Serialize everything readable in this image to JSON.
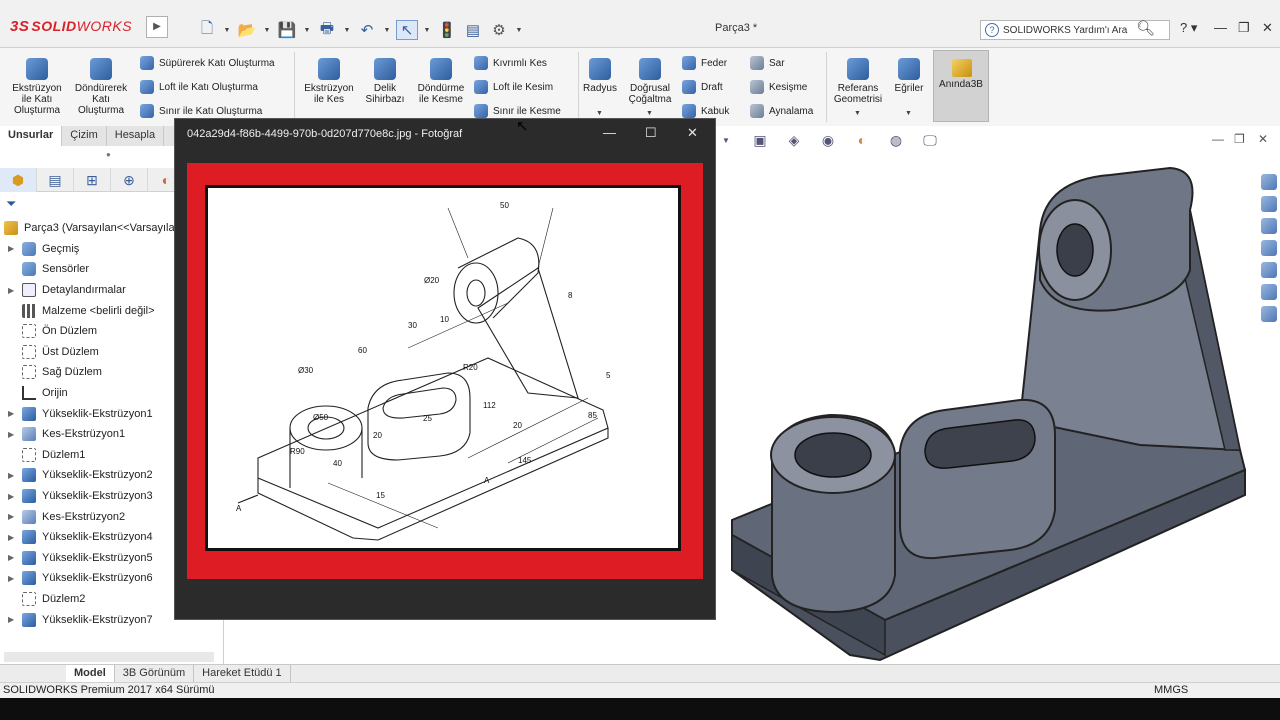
{
  "app": {
    "logo_ds": "3S",
    "logo_solid": "SOLID",
    "logo_works": "WORKS",
    "document_title": "Parça3 *",
    "help_search_placeholder": "SOLIDWORKS Yardım'ı Ara"
  },
  "ribbon": {
    "extrude_boss": "Ekstrüzyon ile Katı Oluşturma",
    "revolve_boss": "Döndürerek Katı Oluşturma",
    "sweep_boss": "Süpürerek Katı Oluşturma",
    "loft_boss": "Loft ile Katı Oluşturma",
    "boundary_boss": "Sınır ile Katı Oluşturma",
    "extrude_cut": "Ekstrüzyon ile Kes",
    "hole_wizard": "Delik Sihirbazı",
    "revolve_cut": "Döndürme ile Kesme",
    "swept_cut": "Kıvrımlı Kes",
    "loft_cut": "Loft ile Kesim",
    "boundary_cut": "Sınır ile Kesme",
    "fillet": "Radyus",
    "linear_pattern": "Doğrusal Çoğaltma",
    "rib": "Feder",
    "draft": "Draft",
    "shell": "Kabuk",
    "wrap": "Sar",
    "intersect": "Kesişme",
    "mirror": "Aynalama",
    "ref_geometry": "Referans Geometrisi",
    "curves": "Eğriler",
    "instant3d": "Anında3B"
  },
  "tabs": {
    "features": "Unsurlar",
    "sketch": "Çizim",
    "evaluate": "Hesapla"
  },
  "tree": {
    "root": "Parça3  (Varsayılan<<Varsayılan",
    "items": [
      {
        "label": "Geçmiş",
        "icon": "folder",
        "exp": true
      },
      {
        "label": "Sensörler",
        "icon": "folder",
        "exp": false
      },
      {
        "label": "Detaylandırmalar",
        "icon": "annot",
        "exp": true
      },
      {
        "label": "Malzeme <belirli değil>",
        "icon": "mat",
        "exp": false
      },
      {
        "label": "Ön Düzlem",
        "icon": "plane",
        "exp": false
      },
      {
        "label": "Üst Düzlem",
        "icon": "plane",
        "exp": false
      },
      {
        "label": "Sağ Düzlem",
        "icon": "plane",
        "exp": false
      },
      {
        "label": "Orijin",
        "icon": "origin",
        "exp": false
      },
      {
        "label": "Yükseklik-Ekstrüzyon1",
        "icon": "feat",
        "exp": true
      },
      {
        "label": "Kes-Ekstrüzyon1",
        "icon": "cut",
        "exp": true
      },
      {
        "label": "Düzlem1",
        "icon": "plane",
        "exp": false
      },
      {
        "label": "Yükseklik-Ekstrüzyon2",
        "icon": "feat",
        "exp": true
      },
      {
        "label": "Yükseklik-Ekstrüzyon3",
        "icon": "feat",
        "exp": true
      },
      {
        "label": "Kes-Ekstrüzyon2",
        "icon": "cut",
        "exp": true
      },
      {
        "label": "Yükseklik-Ekstrüzyon4",
        "icon": "feat",
        "exp": true
      },
      {
        "label": "Yükseklik-Ekstrüzyon5",
        "icon": "feat",
        "exp": true
      },
      {
        "label": "Yükseklik-Ekstrüzyon6",
        "icon": "feat",
        "exp": true
      },
      {
        "label": "Düzlem2",
        "icon": "plane",
        "exp": false
      },
      {
        "label": "Yükseklik-Ekstrüzyon7",
        "icon": "feat",
        "exp": true
      }
    ]
  },
  "bottom_tabs": {
    "model": "Model",
    "view3d": "3B Görünüm",
    "motion": "Hareket Etüdü 1"
  },
  "status": {
    "version": "SOLIDWORKS Premium 2017 x64 Sürümü",
    "units": "MMGS"
  },
  "photo_viewer": {
    "title": "042a29d4-f86b-4499-970b-0d207d770e8c.jpg - Fotoğraf",
    "minimize": "—",
    "maximize": "☐",
    "close": "✕"
  },
  "drawing_dims": {
    "d50": "50",
    "d20": "Ø20",
    "d8": "8",
    "d30": "30",
    "d10": "10",
    "d60": "60",
    "d30b": "Ø30",
    "r20": "R20",
    "d5": "5",
    "d112": "112",
    "d50b": "Ø50",
    "d25": "25",
    "d20b": "20",
    "d85": "85",
    "r90": "R90",
    "d40": "40",
    "d20c": "20",
    "d145": "145",
    "a1": "A",
    "a2": "A",
    "d15": "15"
  },
  "colors": {
    "accent_red": "#dd1c24",
    "model_steel": "#6b7180"
  }
}
